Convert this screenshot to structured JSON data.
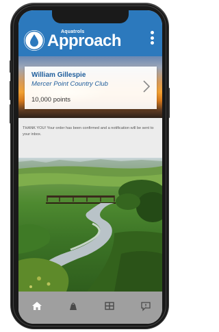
{
  "header": {
    "brand_small": "Aquatrols",
    "brand_title": "Approach",
    "logo_icon": "water-drop-logo-icon",
    "menu_icon": "kebab-menu-icon"
  },
  "profile": {
    "name": "William Gillespie",
    "club": "Mercer Point Country Club",
    "points": "10,000 points",
    "chevron_icon": "chevron-right-icon"
  },
  "message": {
    "text": "THANK YOU! Your order has been confirmed and a notification will be sent to your inbox."
  },
  "nav": {
    "items": [
      {
        "icon": "home-icon"
      },
      {
        "icon": "shop-icon"
      },
      {
        "icon": "rewards-icon"
      },
      {
        "icon": "messages-icon"
      }
    ]
  },
  "colors": {
    "header_blue": "#2c79bd",
    "text_blue": "#1f5e9c",
    "nav_gray": "#9f9f9f"
  }
}
